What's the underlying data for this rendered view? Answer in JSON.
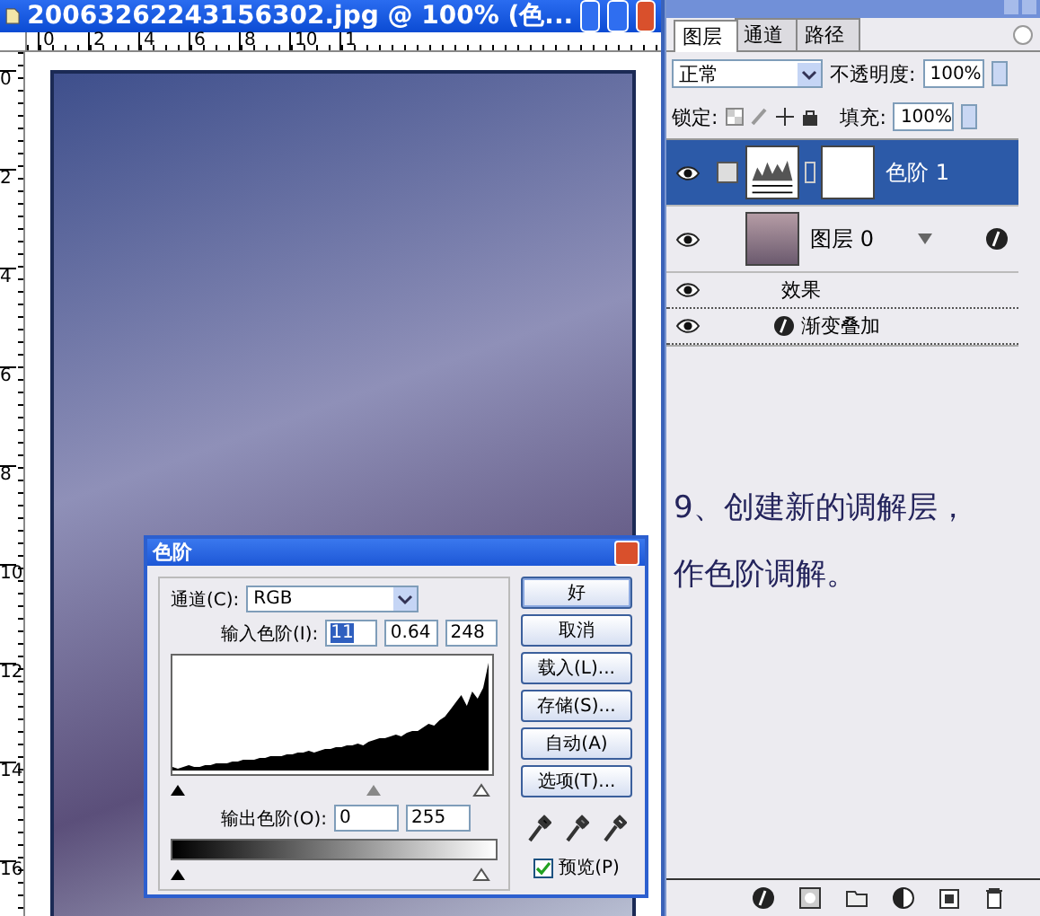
{
  "document": {
    "title": "20063262243156302.jpg @ 100% (色...",
    "h_ruler": [
      "0",
      "2",
      "4",
      "6",
      "8",
      "10",
      "1"
    ],
    "v_ruler": [
      "0",
      "2",
      "4",
      "6",
      "8",
      "10",
      "12",
      "14",
      "16"
    ]
  },
  "levels_dialog": {
    "title": "色阶",
    "channel": {
      "label": "通道(C):",
      "value": "RGB"
    },
    "input_levels": {
      "label": "输入色阶(I):",
      "values": [
        {
          "value": "11",
          "selected": true
        },
        {
          "value": "0.64",
          "selected": false
        },
        {
          "value": "248",
          "selected": false
        }
      ]
    },
    "output_levels": {
      "label": "输出色阶(O):",
      "values": [
        "0",
        "255"
      ]
    },
    "buttons": [
      "好",
      "取消",
      "载入(L)...",
      "存储(S)...",
      "自动(A)",
      "选项(T)..."
    ],
    "preview": {
      "label": "预览(P)",
      "checked": true
    }
  },
  "layers_panel": {
    "tabs": [
      {
        "label": "图层",
        "selected": true
      },
      {
        "label": "通道",
        "selected": false
      },
      {
        "label": "路径",
        "selected": false
      }
    ],
    "blend_mode": "正常",
    "opacity": {
      "label": "不透明度:",
      "value": "100%"
    },
    "lock_label": "锁定:",
    "fill": {
      "label": "填充:",
      "value": "100%"
    },
    "layers": [
      {
        "name": "色阶 1",
        "kind": "adjustment",
        "visible": true,
        "selected": true
      },
      {
        "name": "图层 0",
        "kind": "image",
        "visible": true,
        "selected": false,
        "effects": {
          "label": "效果",
          "visible": true,
          "items": [
            {
              "name": "渐变叠加",
              "visible": true
            }
          ]
        }
      }
    ]
  },
  "caption": [
    "9、创建新的调解层，",
    "作色阶调解。"
  ]
}
